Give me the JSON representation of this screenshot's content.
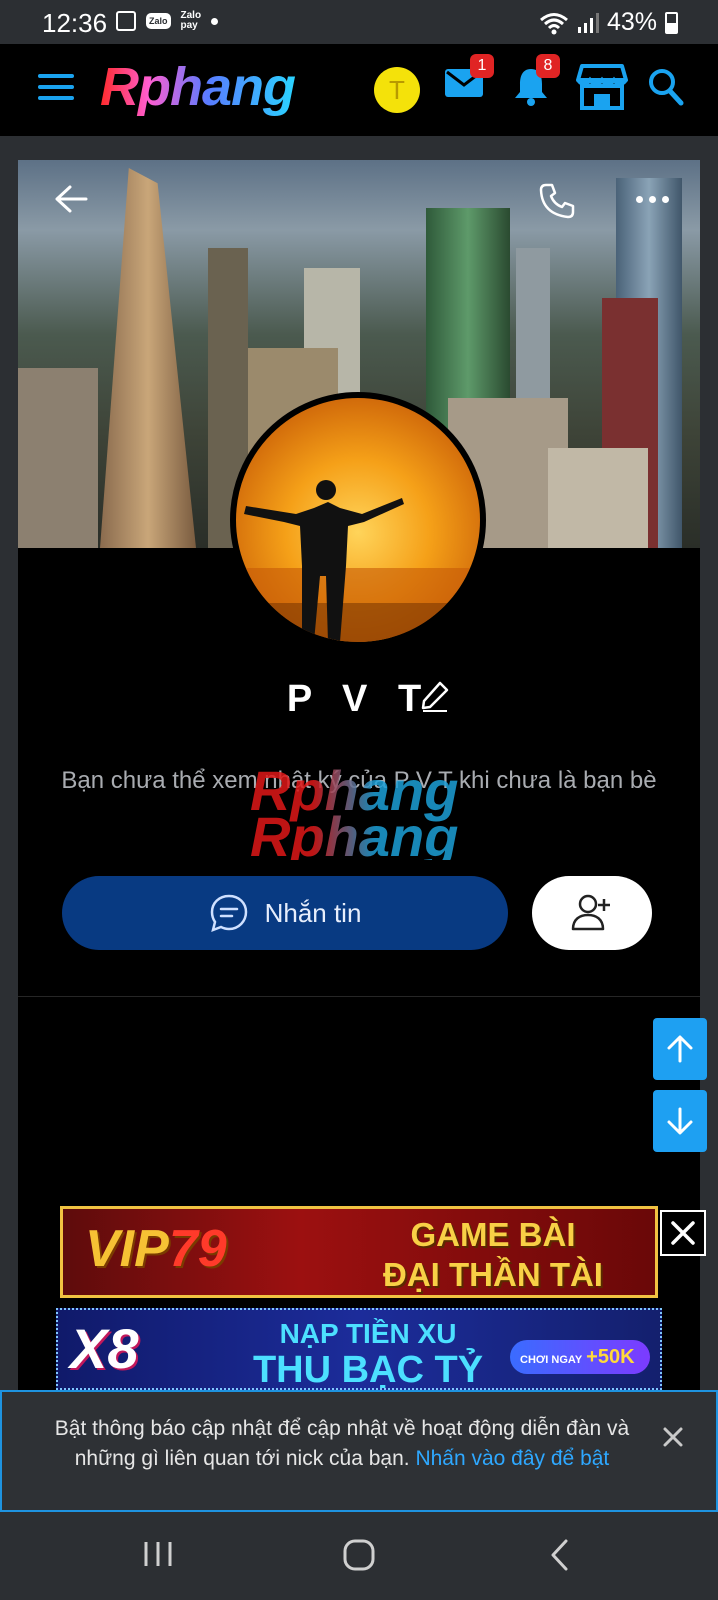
{
  "status_bar": {
    "time": "12:36",
    "zalo_label": "Zalo",
    "zalopay_label_1": "Zalo",
    "zalopay_label_2": "pay",
    "battery": "43%"
  },
  "header": {
    "logo": "Rphang",
    "avatar_letter": "T",
    "messages_badge": "1",
    "alerts_badge": "8"
  },
  "profile": {
    "name": "P V T",
    "notice": "Bạn chưa thể xem nhật ký của P V T khi chưa là bạn bè",
    "watermark": "Rphang",
    "message_button": "Nhắn tin"
  },
  "ads": [
    {
      "brand_1": "VIP",
      "brand_2": "79",
      "line1": "GAME BÀI",
      "line2": "ĐẠI THẦN TÀI"
    },
    {
      "brand": "X8",
      "line1": "NẠP TIỀN XU",
      "line2": "THU BẠC TỶ",
      "cta_small": "CHƠI NGAY",
      "cta_big": "+50K"
    }
  ],
  "notification": {
    "text": "Bật thông báo cập nhật để cập nhật về hoạt động diễn đàn và những gì liên quan tới nick của bạn.",
    "link": "Nhấn vào đây để bật"
  },
  "colors": {
    "accent": "#1ea0f2",
    "message_button": "#083a82",
    "badge": "#e02424"
  }
}
